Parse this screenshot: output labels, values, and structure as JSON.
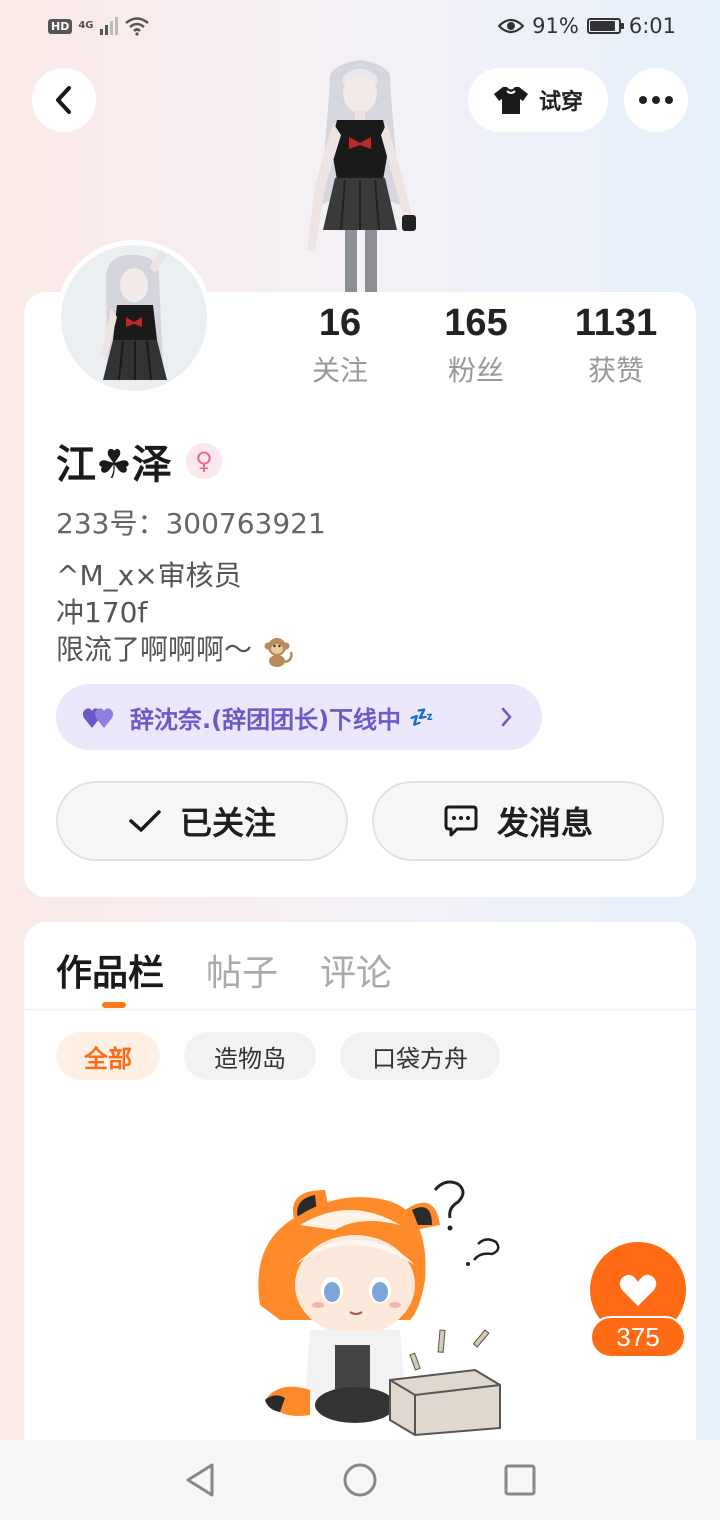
{
  "status_bar": {
    "hd": "HD",
    "network": "4G",
    "battery_percent": "91%",
    "time": "6:01",
    "battery_level": 0.91,
    "icons": [
      "eye-icon",
      "battery-icon",
      "wifi-icon",
      "signal-icon"
    ]
  },
  "header": {
    "tryon_label": "试穿",
    "icons": [
      "back-icon",
      "shirt-icon",
      "more-icon"
    ]
  },
  "profile": {
    "stats": [
      {
        "value": "16",
        "label": "关注"
      },
      {
        "value": "165",
        "label": "粉丝"
      },
      {
        "value": "1131",
        "label": "获赞"
      }
    ],
    "name": "江☘泽",
    "gender_symbol": "♀",
    "uid": "233号：300763921",
    "bio_lines": [
      "^M_x×审核员",
      "冲170f",
      "限流了啊啊啊～"
    ],
    "group_label": "辞沈奈.(辞团团长)下线中",
    "group_suffix": "💤",
    "follow_label": "已关注",
    "message_label": "发消息"
  },
  "works": {
    "tabs": [
      "作品栏",
      "帖子",
      "评论"
    ],
    "active_tab": "作品栏",
    "filters": [
      "全部",
      "造物岛",
      "口袋方舟"
    ],
    "active_filter": "全部"
  },
  "like": {
    "count": "375"
  },
  "colors": {
    "accent": "#ff6a14",
    "group_pill_bg": "#ebe8fb",
    "group_text": "#6a5ac8",
    "gender_pink": "#f06a8f"
  }
}
